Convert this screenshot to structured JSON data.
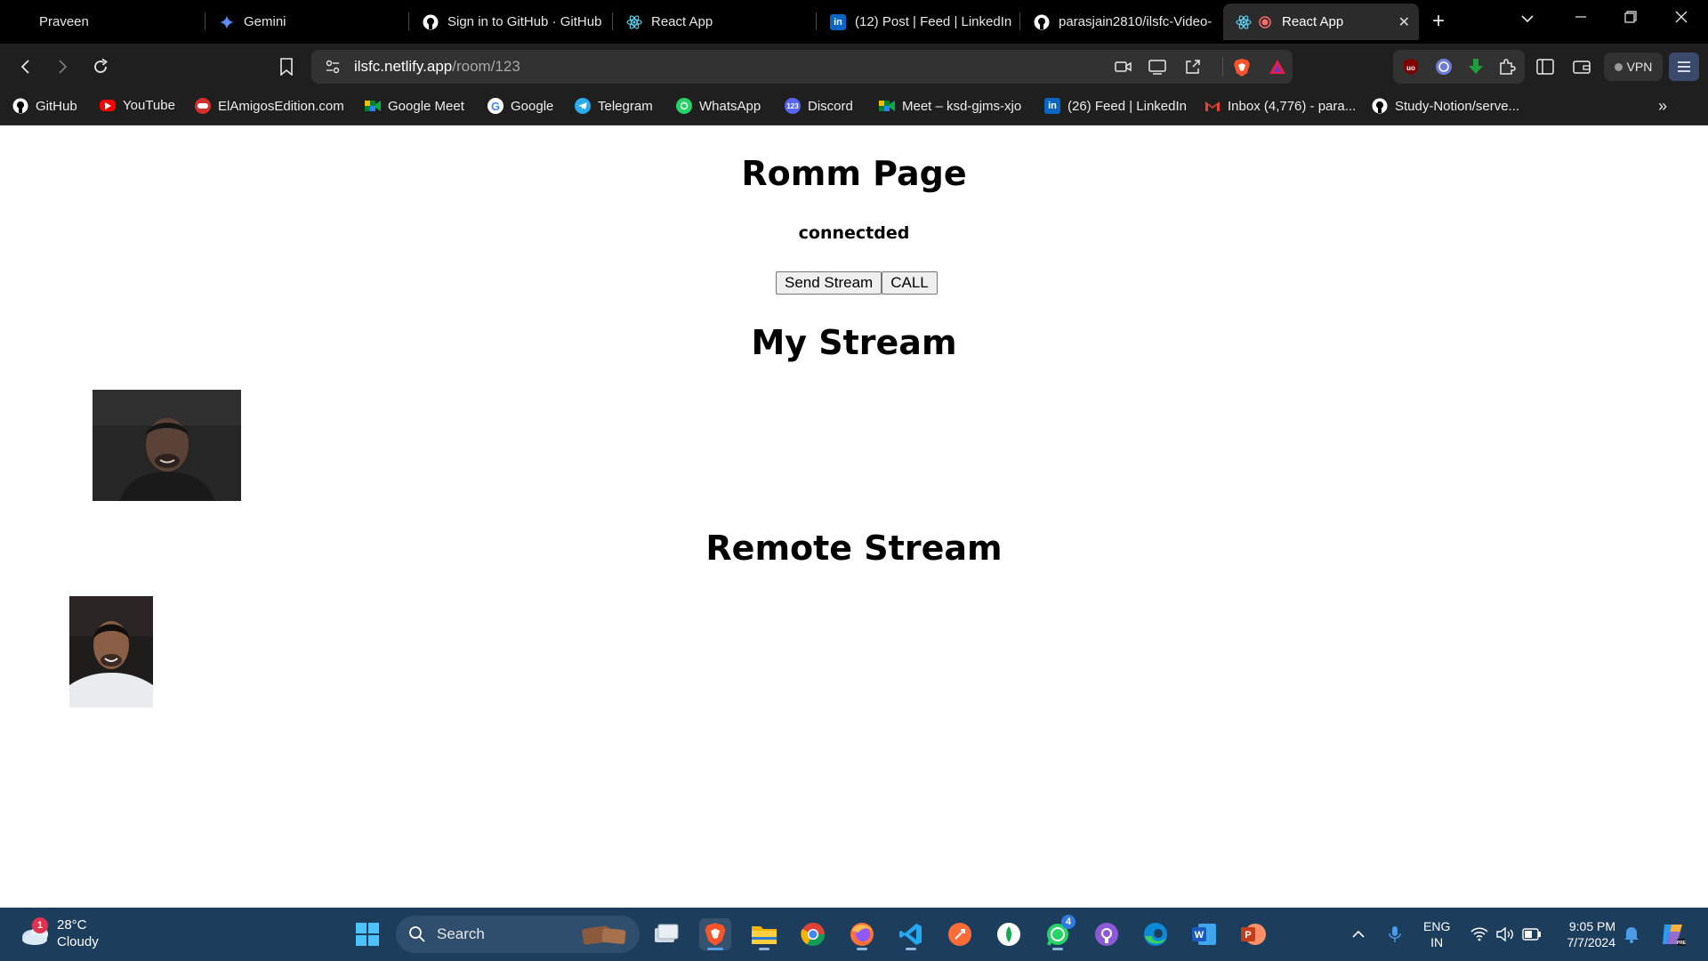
{
  "browser": {
    "tabs": [
      {
        "label": "Praveen",
        "icon": "profile-icon",
        "active": false
      },
      {
        "label": "Gemini",
        "icon": "gemini-icon",
        "active": false
      },
      {
        "label": "Sign in to GitHub · GitHub",
        "icon": "github-icon",
        "active": false
      },
      {
        "label": "React App",
        "icon": "react-icon",
        "active": false
      },
      {
        "label": "(12) Post | Feed | LinkedIn",
        "icon": "linkedin-icon",
        "active": false
      },
      {
        "label": "parasjain2810/ilsfc-Video-",
        "icon": "github-icon",
        "active": false
      },
      {
        "label": "React App",
        "icon": "react-icon",
        "active": true
      }
    ],
    "url_host": "ilsfc.netlify.app",
    "url_path": "/room/123",
    "vpn_label": "VPN",
    "accent": "#3b4a6b"
  },
  "bookmarks": [
    {
      "label": "GitHub",
      "icon": "github-icon"
    },
    {
      "label": "YouTube",
      "icon": "youtube-icon"
    },
    {
      "label": "ElAmigosEdition.com",
      "icon": "gamepad-icon"
    },
    {
      "label": "Google Meet",
      "icon": "meet-icon"
    },
    {
      "label": "Google",
      "icon": "google-icon"
    },
    {
      "label": "Telegram",
      "icon": "telegram-icon"
    },
    {
      "label": "WhatsApp",
      "icon": "whatsapp-icon"
    },
    {
      "label": "Discord",
      "icon": "discord-icon"
    },
    {
      "label": "Meet – ksd-gjms-xjo",
      "icon": "meet-icon"
    },
    {
      "label": "(26) Feed | LinkedIn",
      "icon": "linkedin-icon"
    },
    {
      "label": "Inbox (4,776) - para...",
      "icon": "gmail-icon"
    },
    {
      "label": "Study-Notion/serve...",
      "icon": "github-icon"
    }
  ],
  "page": {
    "title": "Romm Page",
    "status": "connectded",
    "send_stream_label": "Send Stream",
    "call_label": "CALL",
    "my_stream_heading": "My Stream",
    "remote_stream_heading": "Remote Stream"
  },
  "taskbar": {
    "weather_temp": "28°C",
    "weather_desc": "Cloudy",
    "weather_badge": "1",
    "search_placeholder": "Search",
    "whatsapp_badge": "4",
    "lang_line1": "ENG",
    "lang_line2": "IN",
    "time": "9:05 PM",
    "date": "7/7/2024"
  }
}
